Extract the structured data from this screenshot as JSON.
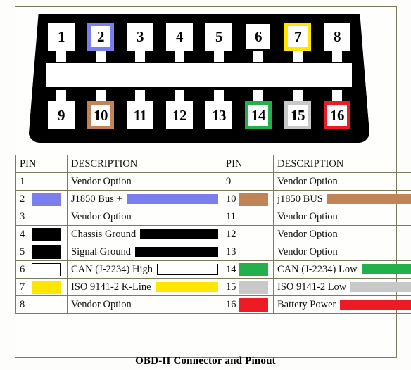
{
  "caption": "OBD-II Connector and Pinout",
  "connector": {
    "top_pins": [
      {
        "number": "1",
        "color": null,
        "style": "plain"
      },
      {
        "number": "2",
        "color": "#7B7FEE",
        "style": "colored"
      },
      {
        "number": "3",
        "color": null,
        "style": "plain"
      },
      {
        "number": "4",
        "color": null,
        "style": "plain"
      },
      {
        "number": "5",
        "color": null,
        "style": "plain"
      },
      {
        "number": "6",
        "color": "#FFFFFF",
        "style": "outlined"
      },
      {
        "number": "7",
        "color": "#FFE600",
        "style": "colored"
      },
      {
        "number": "8",
        "color": null,
        "style": "plain"
      }
    ],
    "bottom_pins": [
      {
        "number": "9",
        "color": null,
        "style": "plain"
      },
      {
        "number": "10",
        "color": "#C08457",
        "style": "colored"
      },
      {
        "number": "11",
        "color": null,
        "style": "plain"
      },
      {
        "number": "12",
        "color": null,
        "style": "plain"
      },
      {
        "number": "13",
        "color": null,
        "style": "plain"
      },
      {
        "number": "14",
        "color": "#22B04A",
        "style": "colored"
      },
      {
        "number": "15",
        "color": "#C8C8C8",
        "style": "colored"
      },
      {
        "number": "16",
        "color": "#ED1C24",
        "style": "colored"
      }
    ]
  },
  "table": {
    "headers": [
      "PIN",
      "DESCRIPTION",
      "PIN",
      "DESCRIPTION"
    ],
    "rows": [
      {
        "left": {
          "pin": "1",
          "desc": "Vendor Option",
          "swatch": null,
          "swatch_style": "none"
        },
        "right": {
          "pin": "9",
          "desc": "Vendor Option",
          "swatch": null,
          "swatch_style": "none"
        }
      },
      {
        "left": {
          "pin": "2",
          "desc": "J1850 Bus +",
          "swatch": "#7B7FEE",
          "swatch_style": "fill"
        },
        "right": {
          "pin": "10",
          "desc": "j1850 BUS",
          "swatch": "#C08457",
          "swatch_style": "fill"
        }
      },
      {
        "left": {
          "pin": "3",
          "desc": "Vendor Option",
          "swatch": null,
          "swatch_style": "none"
        },
        "right": {
          "pin": "11",
          "desc": "Vendor Option",
          "swatch": null,
          "swatch_style": "none"
        }
      },
      {
        "left": {
          "pin": "4",
          "desc": "Chassis Ground",
          "swatch": "#000000",
          "swatch_style": "fill"
        },
        "right": {
          "pin": "12",
          "desc": "Vendor Option",
          "swatch": null,
          "swatch_style": "none"
        }
      },
      {
        "left": {
          "pin": "5",
          "desc": "Signal Ground",
          "swatch": "#000000",
          "swatch_style": "fill"
        },
        "right": {
          "pin": "13",
          "desc": "Vendor Option",
          "swatch": null,
          "swatch_style": "none"
        }
      },
      {
        "left": {
          "pin": "6",
          "desc": "CAN (J-2234) High",
          "swatch": "#FFFFFF",
          "swatch_style": "outline"
        },
        "right": {
          "pin": "14",
          "desc": "CAN (J-2234) Low",
          "swatch": "#22B04A",
          "swatch_style": "fill"
        }
      },
      {
        "left": {
          "pin": "7",
          "desc": "ISO 9141-2 K-Line",
          "swatch": "#FFE600",
          "swatch_style": "fill"
        },
        "right": {
          "pin": "15",
          "desc": "ISO 9141-2 Low",
          "swatch": "#C8C8C8",
          "swatch_style": "fill"
        }
      },
      {
        "left": {
          "pin": "8",
          "desc": "Vendor Option",
          "swatch": null,
          "swatch_style": "none"
        },
        "right": {
          "pin": "16",
          "desc": "Battery Power",
          "swatch": "#ED1C24",
          "swatch_style": "fill"
        }
      }
    ]
  }
}
